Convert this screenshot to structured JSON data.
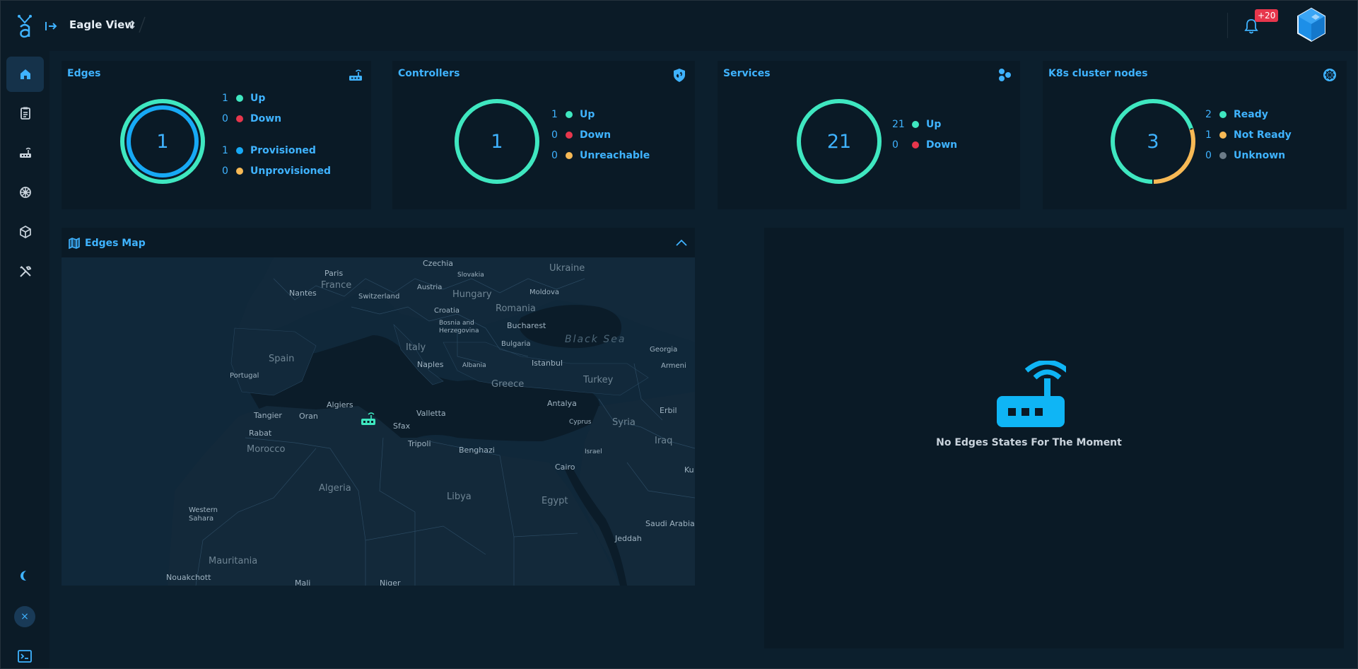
{
  "header": {
    "project_name": "Eagle View",
    "notification_badge": "+20"
  },
  "sidebar": {
    "items": [
      {
        "name": "home",
        "icon": "home-icon",
        "active": true
      },
      {
        "name": "clipboard",
        "icon": "clipboard-icon",
        "active": false
      },
      {
        "name": "edges",
        "icon": "router-icon",
        "active": false
      },
      {
        "name": "kubernetes",
        "icon": "helm-wheel-icon",
        "active": false
      },
      {
        "name": "packages",
        "icon": "cube-icon",
        "active": false
      },
      {
        "name": "tools",
        "icon": "tools-icon",
        "active": false
      }
    ],
    "close_label": "×"
  },
  "cards": {
    "edges": {
      "title": "Edges",
      "value": "1",
      "stats": [
        {
          "count": "1",
          "label": "Up",
          "color": "#3fe7c0"
        },
        {
          "count": "0",
          "label": "Down",
          "color": "#e7364c"
        },
        {
          "count": "1",
          "label": "Provisioned",
          "color": "#17a9f5"
        },
        {
          "count": "0",
          "label": "Unprovisioned",
          "color": "#f7b955"
        }
      ]
    },
    "controllers": {
      "title": "Controllers",
      "value": "1",
      "stats": [
        {
          "count": "1",
          "label": "Up",
          "color": "#3fe7c0"
        },
        {
          "count": "0",
          "label": "Down",
          "color": "#e7364c"
        },
        {
          "count": "0",
          "label": "Unreachable",
          "color": "#f7b955"
        }
      ]
    },
    "services": {
      "title": "Services",
      "value": "21",
      "stats": [
        {
          "count": "21",
          "label": "Up",
          "color": "#3fe7c0"
        },
        {
          "count": "0",
          "label": "Down",
          "color": "#e7364c"
        }
      ]
    },
    "k8s": {
      "title": "K8s cluster nodes",
      "value": "3",
      "stats": [
        {
          "count": "2",
          "label": "Ready",
          "color": "#3fe7c0"
        },
        {
          "count": "1",
          "label": "Not Ready",
          "color": "#f7b955"
        },
        {
          "count": "0",
          "label": "Unknown",
          "color": "#6b7b88"
        }
      ]
    }
  },
  "map": {
    "title": "Edges Map",
    "labels": {
      "czechia": "Czechia",
      "ukraine": "Ukraine",
      "slovakia": "Slovakia",
      "paris": "Paris",
      "france": "France",
      "austria": "Austria",
      "nantes": "Nantes",
      "switzerland": "Switzerland",
      "hungary": "Hungary",
      "moldova": "Moldova",
      "romania": "Romania",
      "croatia": "Croatia",
      "bosnia": "Bosnia and Herzegovina",
      "bucharest": "Bucharest",
      "black_sea": "Black Sea",
      "bulgaria": "Bulgaria",
      "georgia": "Georgia",
      "spain": "Spain",
      "italy": "Italy",
      "portugal": "Portugal",
      "naples": "Naples",
      "albania": "Albania",
      "istanbul": "Istanbul",
      "armenia": "Armeni",
      "greece": "Greece",
      "turkey": "Turkey",
      "algiers": "Algiers",
      "antalya": "Antalya",
      "tangier": "Tangier",
      "oran": "Oran",
      "sfax": "Sfax",
      "valletta": "Valletta",
      "cyprus": "Cyprus",
      "syria": "Syria",
      "erbil": "Erbil",
      "rabat": "Rabat",
      "tripoli": "Tripoli",
      "morocco": "Morocco",
      "benghazi": "Benghazi",
      "iraq": "Iraq",
      "israel": "Israel",
      "cairo": "Cairo",
      "ku": "Ku",
      "algeria": "Algeria",
      "libya": "Libya",
      "egypt": "Egypt",
      "western_sahara": "Western Sahara",
      "saudi_arabia": "Saudi Arabia",
      "jeddah": "Jeddah",
      "mauritania": "Mauritania",
      "nouakchott": "Nouakchott",
      "mali": "Mali",
      "niger": "Niger"
    }
  },
  "edge_states": {
    "empty_message": "No Edges States For The Moment"
  }
}
